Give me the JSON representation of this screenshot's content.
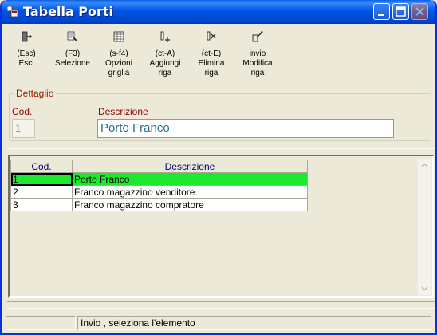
{
  "window": {
    "title": "Tabella Porti"
  },
  "toolbar": [
    {
      "icon": "exit-icon",
      "label": "(Esc)\nEsci"
    },
    {
      "icon": "select-icon",
      "label": "(F3)\nSelezione"
    },
    {
      "icon": "grid-options-icon",
      "label": "(s-f4)\nOpzioni\ngriglia"
    },
    {
      "icon": "add-row-icon",
      "label": "(ct-A)\nAggiungi\nriga"
    },
    {
      "icon": "delete-row-icon",
      "label": "(ct-E)\nElimina\nriga"
    },
    {
      "icon": "edit-row-icon",
      "label": "invio\nModifica\nriga"
    }
  ],
  "detail": {
    "legend": "Dettaglio",
    "cod_label": "Cod.",
    "cod_value": "1",
    "desc_label": "Descrizione",
    "desc_value": "Porto Franco"
  },
  "grid": {
    "columns": [
      "Cod.",
      "Descrizione"
    ],
    "rows": [
      {
        "cod": "1",
        "desc": "Porto Franco",
        "selected": true
      },
      {
        "cod": "2",
        "desc": "Franco magazzino venditore",
        "selected": false
      },
      {
        "cod": "3",
        "desc": "Franco magazzino compratore",
        "selected": false
      }
    ],
    "selected_row_color": "#1ee82d"
  },
  "status": {
    "message": "Invio , seleziona l'elemento"
  }
}
